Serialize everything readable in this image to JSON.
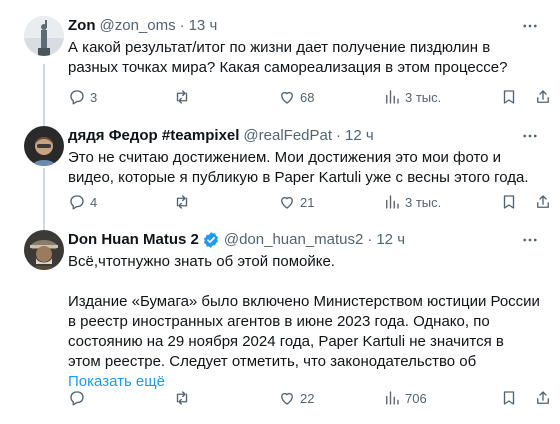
{
  "tweets": [
    {
      "name": "Zon",
      "handle": "@zon_oms",
      "time": "13 ч",
      "verified": false,
      "paragraphs": [
        "А какой результат/итог по жизни дает получение пиздюлин в разных точках мира? Какая самореализация в этом процессе?"
      ],
      "show_more": "",
      "replies": "3",
      "retweets": "",
      "likes": "68",
      "views": "3 тыс."
    },
    {
      "name": "дядя Федор #teampixel",
      "handle": "@realFedPat",
      "time": "12 ч",
      "verified": false,
      "paragraphs": [
        "Это не считаю достижением. Мои достижения это мои фото и видео, которые я публикую в Paper Kartuli уже с весны этого года."
      ],
      "show_more": "",
      "replies": "4",
      "retweets": "",
      "likes": "21",
      "views": "3 тыс."
    },
    {
      "name": "Don Huan Matus 2",
      "handle": "@don_huan_matus2",
      "time": "12 ч",
      "verified": true,
      "paragraphs": [
        "Всё,чтотнужно знать об этой помойке.",
        "Издание «Бумага» было включено Министерством юстиции России в реестр иностранных агентов в июне 2023 года.  Однако, по состоянию на 29 ноября 2024 года, Paper Kartuli не значится в этом реестре. Следует отметить, что законодательство об"
      ],
      "show_more": "Показать ещё",
      "replies": "",
      "retweets": "",
      "likes": "22",
      "views": "706"
    }
  ],
  "dot": "·",
  "colors": {
    "text": "#0f1419",
    "secondary": "#536471",
    "link": "#1d9bf0",
    "verified": "#1d9bf0",
    "line": "#cfd9de"
  }
}
